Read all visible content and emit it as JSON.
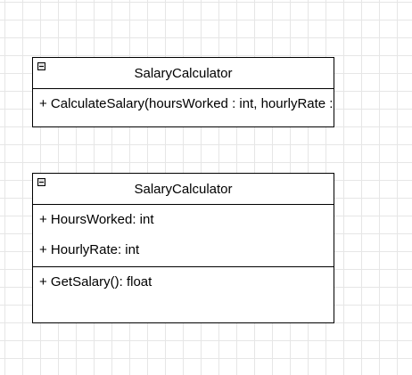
{
  "classes": [
    {
      "name": "SalaryCalculator",
      "attributes": [],
      "operations": [
        "+ CalculateSalary(hoursWorked : int, hourlyRate : float)"
      ]
    },
    {
      "name": "SalaryCalculator",
      "attributes": [
        "+ HoursWorked: int",
        "+ HourlyRate: int"
      ],
      "operations": [
        "+ GetSalary(): float"
      ]
    }
  ]
}
